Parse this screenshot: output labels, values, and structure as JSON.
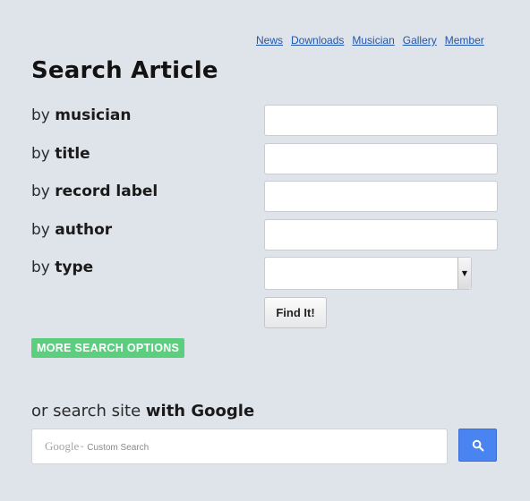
{
  "nav": {
    "links": [
      "News",
      "Downloads",
      "Musician",
      "Gallery",
      "Member"
    ],
    "link_color": "#1f57b0"
  },
  "page": {
    "title": "Search Article"
  },
  "form": {
    "rows": [
      {
        "prefix": "by",
        "field": "musician",
        "value": ""
      },
      {
        "prefix": "by",
        "field": "title",
        "value": ""
      },
      {
        "prefix": "by",
        "field": "record label",
        "value": ""
      },
      {
        "prefix": "by",
        "field": "author",
        "value": ""
      },
      {
        "prefix": "by",
        "field": "type",
        "value": ""
      }
    ],
    "type_select": {
      "selected": ""
    },
    "submit_label": "Find It!"
  },
  "more_options": {
    "label": "MORE SEARCH OPTIONS",
    "color": "#5ccf7f"
  },
  "google": {
    "heading_prefix": "or search site",
    "heading_strong": "with Google",
    "logo_text": "Google",
    "tm": "™",
    "watermark_text": "Custom Search",
    "input_value": "",
    "button_icon": "search-icon",
    "button_color": "#4a84f0"
  },
  "colors": {
    "background": "#dfe3ea"
  }
}
